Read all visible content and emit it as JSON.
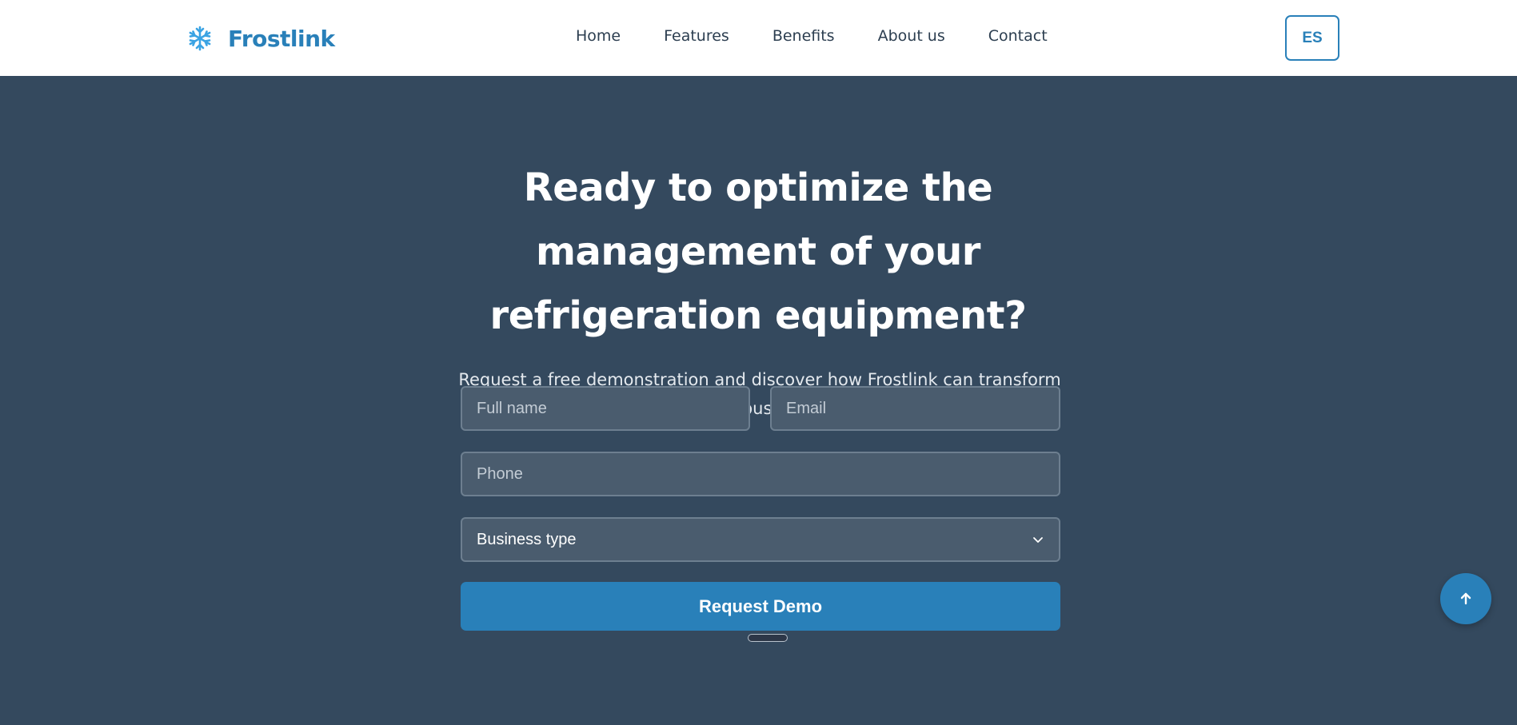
{
  "brand": {
    "name": "Frostlink",
    "icon": "snowflake-icon",
    "color": "#2980b9",
    "icon_color": "#3aa3e3"
  },
  "nav": {
    "links": [
      {
        "label": "Home"
      },
      {
        "label": "Features"
      },
      {
        "label": "Benefits"
      },
      {
        "label": "About us"
      },
      {
        "label": "Contact"
      }
    ]
  },
  "language_toggle": {
    "label": "ES"
  },
  "hero": {
    "title": "Ready to optimize the management of your refrigeration equipment?",
    "subtitle": "Request a free demonstration and discover how Frostlink can transform your business."
  },
  "form": {
    "name_placeholder": "Full name",
    "email_placeholder": "Email",
    "phone_placeholder": "Phone",
    "business_type_selected": "Business type",
    "submit_label": "Request Demo"
  },
  "back_to_top": {
    "icon": "arrow-up-icon"
  },
  "colors": {
    "hero_bg": "#34495e",
    "accent": "#2980b9",
    "nav_text": "#2c3e50"
  }
}
